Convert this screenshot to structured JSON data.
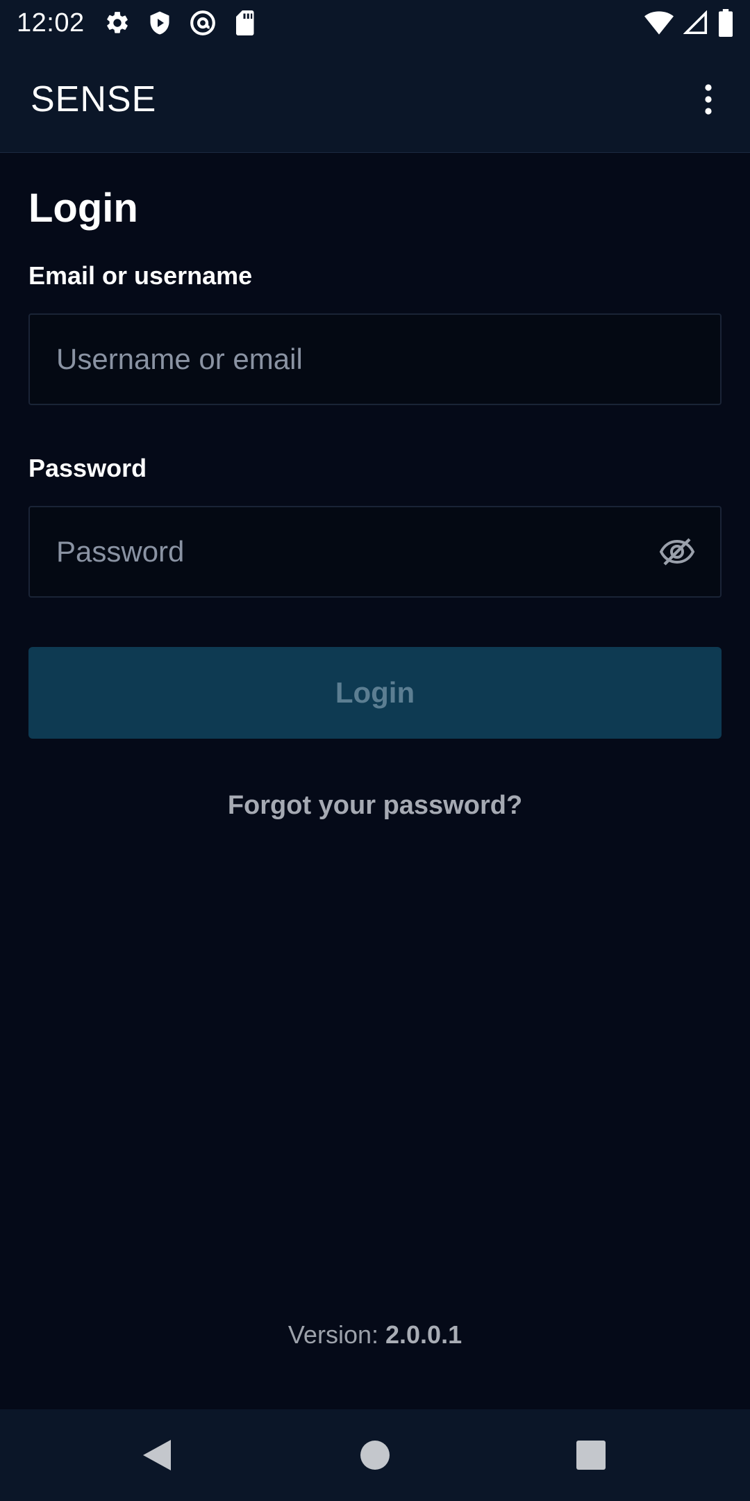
{
  "status_bar": {
    "time": "12:02",
    "left_icons": [
      "settings-icon",
      "shield-play-icon",
      "at-sign-icon",
      "sd-card-icon"
    ],
    "right_icons": [
      "wifi-icon",
      "cell-signal-icon",
      "battery-icon"
    ]
  },
  "app_bar": {
    "title": "SENSE",
    "overflow_icon": "more-vert-icon"
  },
  "login": {
    "title": "Login",
    "email_label": "Email or username",
    "email_placeholder": "Username or email",
    "email_value": "",
    "password_label": "Password",
    "password_placeholder": "Password",
    "password_value": "",
    "password_toggle_icon": "eye-off-icon",
    "submit_label": "Login",
    "forgot_label": "Forgot your password?"
  },
  "footer": {
    "version_prefix": "Version: ",
    "version_number": "2.0.0.1"
  },
  "nav_bar": {
    "buttons": [
      "back-icon",
      "home-icon",
      "recents-icon"
    ]
  },
  "colors": {
    "background": "#050a18",
    "bar": "#0b1628",
    "button": "#0e3a52",
    "button_text": "#5c7e92"
  }
}
